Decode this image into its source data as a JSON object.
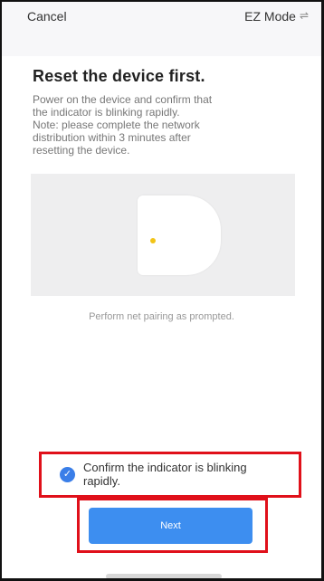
{
  "header": {
    "cancel_label": "Cancel",
    "mode_label": "EZ Mode",
    "mode_icon": "swap-icon"
  },
  "main": {
    "title": "Reset the device first.",
    "description": "Power on the device and confirm that\nthe indicator is blinking rapidly.\nNote: please complete the network\ndistribution within 3 minutes after\nresetting the device.",
    "prompt": "Perform net pairing as prompted."
  },
  "confirm": {
    "checked": true,
    "label": "Confirm the indicator is blinking rapidly."
  },
  "footer": {
    "next_label": "Next"
  },
  "colors": {
    "accent": "#3d8ef0",
    "checkbox": "#3a7ee8",
    "highlight": "#e0101a",
    "indicator": "#f2c417"
  }
}
